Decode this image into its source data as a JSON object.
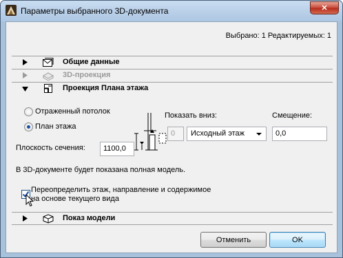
{
  "window": {
    "title": "Параметры выбранного 3D-документа",
    "close_glyph": "✕",
    "selected_info": "Выбрано: 1 Редактируемых: 1"
  },
  "sections": {
    "general": "Общие данные",
    "projection": "3D-проекция",
    "floorplan": "Проекция Плана этажа",
    "model": "Показ модели"
  },
  "floorplan": {
    "radio_ceiling": "Отраженный потолок",
    "radio_floorplan": "План этажа",
    "selected_option": "План этажа",
    "show_down_label": "Показать вниз:",
    "show_down_count": "0",
    "show_down_select": "Исходный этаж",
    "offset_label": "Смещение:",
    "offset_value": "0,0",
    "cut_plane_label": "Плоскость сечения:",
    "cut_plane_value": "1100,0",
    "info_text": "В 3D-документе будет показана полная модель.",
    "override_line1": "Переопределить этаж, направление и содержимое",
    "override_line2": "на основе текущего вида",
    "override_checked": true
  },
  "buttons": {
    "cancel": "Отменить",
    "ok": "OK"
  },
  "colors": {
    "titlebar": "#adc6e2",
    "close": "#c7493a",
    "client": "#f0f0f0",
    "check": "#1b4fa8"
  }
}
